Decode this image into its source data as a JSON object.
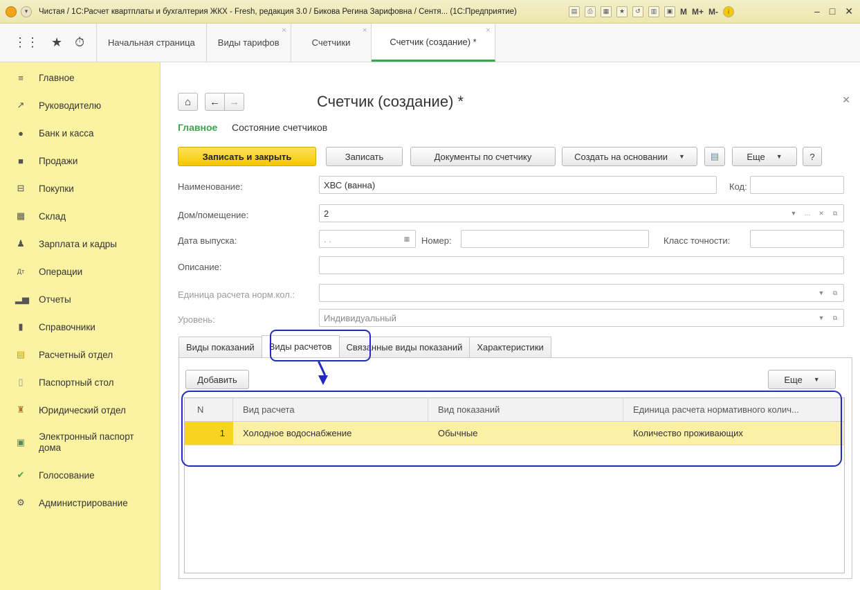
{
  "titlebar": {
    "title": "Чистая / 1С:Расчет квартплаты и бухгалтерия ЖКХ - Fresh, редакция 3.0 / Бикова Регина Зарифовна / Сентя...  (1С:Предприятие)",
    "memory_buttons": [
      "M",
      "M+",
      "M-"
    ]
  },
  "tabs": [
    {
      "label": "Начальная страница",
      "closable": false
    },
    {
      "label": "Виды тарифов",
      "closable": true
    },
    {
      "label": "Счетчики",
      "closable": true
    },
    {
      "label": "Счетчик (создание) *",
      "closable": true,
      "active": true
    }
  ],
  "sidebar": {
    "items": [
      {
        "label": "Главное",
        "icon": "menu-icon"
      },
      {
        "label": "Руководителю",
        "icon": "chart-line-icon"
      },
      {
        "label": "Банк и касса",
        "icon": "bank-icon"
      },
      {
        "label": "Продажи",
        "icon": "shopping-bag-icon"
      },
      {
        "label": "Покупки",
        "icon": "cart-icon"
      },
      {
        "label": "Склад",
        "icon": "warehouse-icon"
      },
      {
        "label": "Зарплата и кадры",
        "icon": "person-icon"
      },
      {
        "label": "Операции",
        "icon": "dt-kt-icon"
      },
      {
        "label": "Отчеты",
        "icon": "bar-chart-icon"
      },
      {
        "label": "Справочники",
        "icon": "book-icon"
      },
      {
        "label": "Расчетный отдел",
        "icon": "calculator-icon"
      },
      {
        "label": "Паспортный стол",
        "icon": "passport-icon"
      },
      {
        "label": "Юридический отдел",
        "icon": "legal-icon"
      },
      {
        "label": "Электронный паспорт дома",
        "icon": "xml-doc-icon"
      },
      {
        "label": "Голосование",
        "icon": "check-vote-icon"
      },
      {
        "label": "Администрирование",
        "icon": "gear-icon"
      }
    ]
  },
  "form": {
    "title": "Счетчик (создание) *",
    "subnav": {
      "main": "Главное",
      "state": "Состояние счетчиков"
    },
    "toolbar": {
      "save_close": "Записать и закрыть",
      "save": "Записать",
      "documents": "Документы по счетчику",
      "create_based": "Создать на основании",
      "more": "Еще",
      "help": "?"
    },
    "fields": {
      "name_label": "Наименование:",
      "name_value": "ХВС (ванна)",
      "code_label": "Код:",
      "code_value": "",
      "house_label": "Дом/помещение:",
      "house_value": "2",
      "release_label": "Дата выпуска:",
      "release_value": ". .",
      "number_label": "Номер:",
      "number_value": "",
      "accuracy_label": "Класс точности:",
      "accuracy_value": "",
      "desc_label": "Описание:",
      "desc_value": "",
      "unit_label": "Единица расчета норм.кол.:",
      "unit_value": "",
      "level_label": "Уровень:",
      "level_value": "Индивидуальный"
    },
    "inner_tabs": [
      "Виды показаний",
      "Виды расчетов",
      "Связанные виды показаний",
      "Характеристики"
    ],
    "active_inner_tab": "Виды расчетов",
    "table_toolbar": {
      "add": "Добавить",
      "more": "Еще"
    },
    "table": {
      "columns": [
        "N",
        "Вид расчета",
        "Вид показаний",
        "Единица расчета нормативного колич..."
      ],
      "rows": [
        {
          "n": "1",
          "calc_type": "Холодное водоснабжение",
          "reading_type": "Обычные",
          "unit": "Количество проживающих"
        }
      ]
    }
  },
  "colors": {
    "sidebar_bg": "#fbf3a2",
    "primary_button": "#f5c800",
    "active_tab_accent": "#3aa54a",
    "highlight": "#1f2bbf",
    "selected_row": "#fbf0a6"
  }
}
